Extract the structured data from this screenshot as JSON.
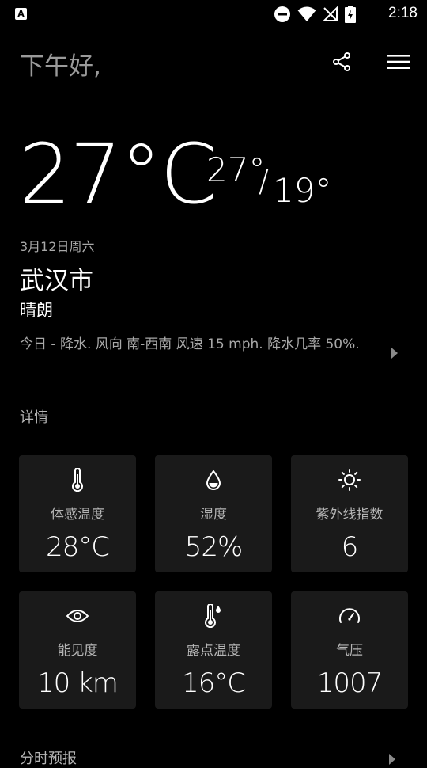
{
  "status_bar": {
    "app_icon_letter": "A",
    "time": "2:18"
  },
  "header": {
    "greeting": "下午好,"
  },
  "current": {
    "temperature": "27°C",
    "high": "27°",
    "separator": "/",
    "low": "19°",
    "date": "3月12日周六",
    "city": "武汉市",
    "condition": "晴朗",
    "forecast": "今日 - 降水. 风向 南-西南 风速 15 mph. 降水几率 50%."
  },
  "details": {
    "title": "详情",
    "cards": [
      {
        "label": "体感温度",
        "value": "28°C",
        "icon": "thermometer-icon"
      },
      {
        "label": "湿度",
        "value": "52%",
        "icon": "humidity-drop-icon"
      },
      {
        "label": "紫外线指数",
        "value": "6",
        "icon": "sun-icon"
      },
      {
        "label": "能见度",
        "value": "10 km",
        "icon": "eye-icon"
      },
      {
        "label": "露点温度",
        "value": "16°C",
        "icon": "dew-point-thermometer-icon"
      },
      {
        "label": "气压",
        "value": "1007",
        "icon": "gauge-icon"
      }
    ]
  },
  "hourly": {
    "title": "分时预报"
  },
  "colors": {
    "background": "#000000",
    "card": "#1a1a1a",
    "secondary_text": "#a8a8a8"
  }
}
